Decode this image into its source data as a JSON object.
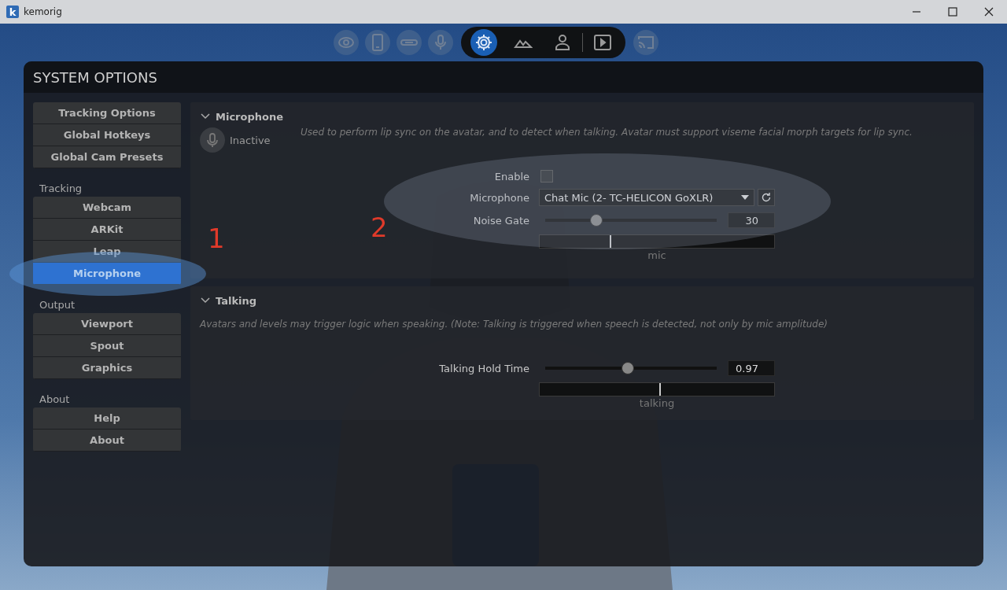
{
  "window": {
    "logo": "k",
    "title": "kemorig"
  },
  "toolbar": {
    "buttons": [
      {
        "kind": "eye",
        "grouped": false,
        "selected": false
      },
      {
        "kind": "phone",
        "grouped": false,
        "selected": false
      },
      {
        "kind": "sensor",
        "grouped": false,
        "selected": false
      },
      {
        "kind": "mic",
        "grouped": false,
        "selected": false
      },
      {
        "kind": "gear",
        "grouped": true,
        "selected": true
      },
      {
        "kind": "mountains",
        "grouped": true,
        "selected": false
      },
      {
        "kind": "person",
        "grouped": true,
        "selected": false
      },
      {
        "kind": "play",
        "grouped": true,
        "selected": false
      },
      {
        "kind": "cast",
        "grouped": false,
        "selected": false
      }
    ]
  },
  "panel": {
    "title": "SYSTEM OPTIONS"
  },
  "sidebar": {
    "groups": [
      {
        "items": [
          {
            "label": "Tracking Options",
            "selected": false
          },
          {
            "label": "Global Hotkeys",
            "selected": false
          },
          {
            "label": "Global Cam Presets",
            "selected": false
          }
        ]
      },
      {
        "heading": "Tracking",
        "items": [
          {
            "label": "Webcam",
            "selected": false
          },
          {
            "label": "ARKit",
            "selected": false
          },
          {
            "label": "Leap",
            "selected": false
          },
          {
            "label": "Microphone",
            "selected": true
          }
        ]
      },
      {
        "heading": "Output",
        "items": [
          {
            "label": "Viewport",
            "selected": false
          },
          {
            "label": "Spout",
            "selected": false
          },
          {
            "label": "Graphics",
            "selected": false
          }
        ]
      },
      {
        "heading": "About",
        "items": [
          {
            "label": "Help",
            "selected": false
          },
          {
            "label": "About",
            "selected": false
          }
        ]
      }
    ]
  },
  "sections": [
    {
      "title": "Microphone",
      "expanded": true,
      "status": "Inactive",
      "description": "Used to perform lip sync on the avatar, and to detect when talking. Avatar must support viseme facial morph targets for lip sync.",
      "rows": [
        {
          "kind": "checkbox",
          "label": "Enable",
          "checked": false
        },
        {
          "kind": "dropdown",
          "label": "Microphone",
          "value": "Chat Mic (2- TC-HELICON GoXLR)"
        },
        {
          "kind": "slider",
          "label": "Noise Gate",
          "level": 0.3,
          "reading": "30"
        },
        {
          "kind": "meter",
          "level": 0.3,
          "caption": "mic"
        }
      ]
    },
    {
      "title": "Talking",
      "expanded": true,
      "description": "Avatars and levels may trigger logic when speaking. (Note: Talking is triggered when speech is detected, not only by mic amplitude)",
      "rows": [
        {
          "kind": "slider",
          "label": "Talking Hold Time",
          "level": 0.48,
          "reading": "0.97"
        },
        {
          "kind": "meter",
          "level": 0.51,
          "caption": "talking"
        }
      ]
    }
  ],
  "annotations": [
    {
      "text": "1"
    },
    {
      "text": "2"
    }
  ]
}
